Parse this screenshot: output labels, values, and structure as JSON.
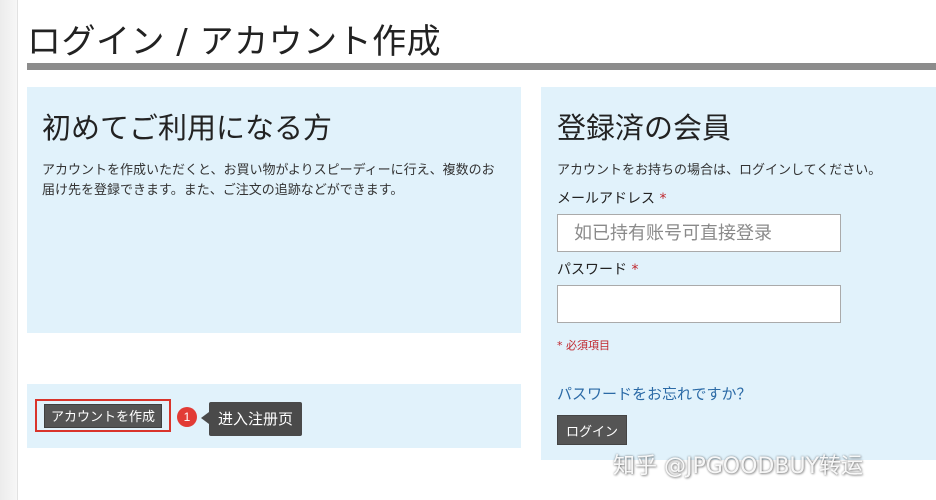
{
  "page": {
    "title": "ログイン / アカウント作成"
  },
  "new_customer": {
    "heading": "初めてご利用になる方",
    "description": "アカウントを作成いただくと、お買い物がよりスピーディーに行え、複数のお届け先を登録できます。また、ご注文の追跡などができます。",
    "create_button_label": "アカウントを作成"
  },
  "registered": {
    "heading": "登録済の会員",
    "description": "アカウントをお持ちの場合は、ログインしてください。",
    "email_label": "メールアドレス",
    "email_placeholder": "如已持有账号可直接登录",
    "password_label": "パスワード",
    "required_mark": "*",
    "required_note": "* 必須項目",
    "forgot_link": "パスワードをお忘れですか？",
    "login_button_label": "ログイン"
  },
  "annotation": {
    "step_number": "1",
    "callout_text": "进入注册页",
    "highlight_color": "#d9342b"
  },
  "watermark": {
    "text": "知乎 @JPGOODBUY转运"
  },
  "colors": {
    "panel_background": "#e1f2fb",
    "button_background": "#555555",
    "required_red": "#c0262d",
    "link_blue": "#2b6aa6"
  }
}
